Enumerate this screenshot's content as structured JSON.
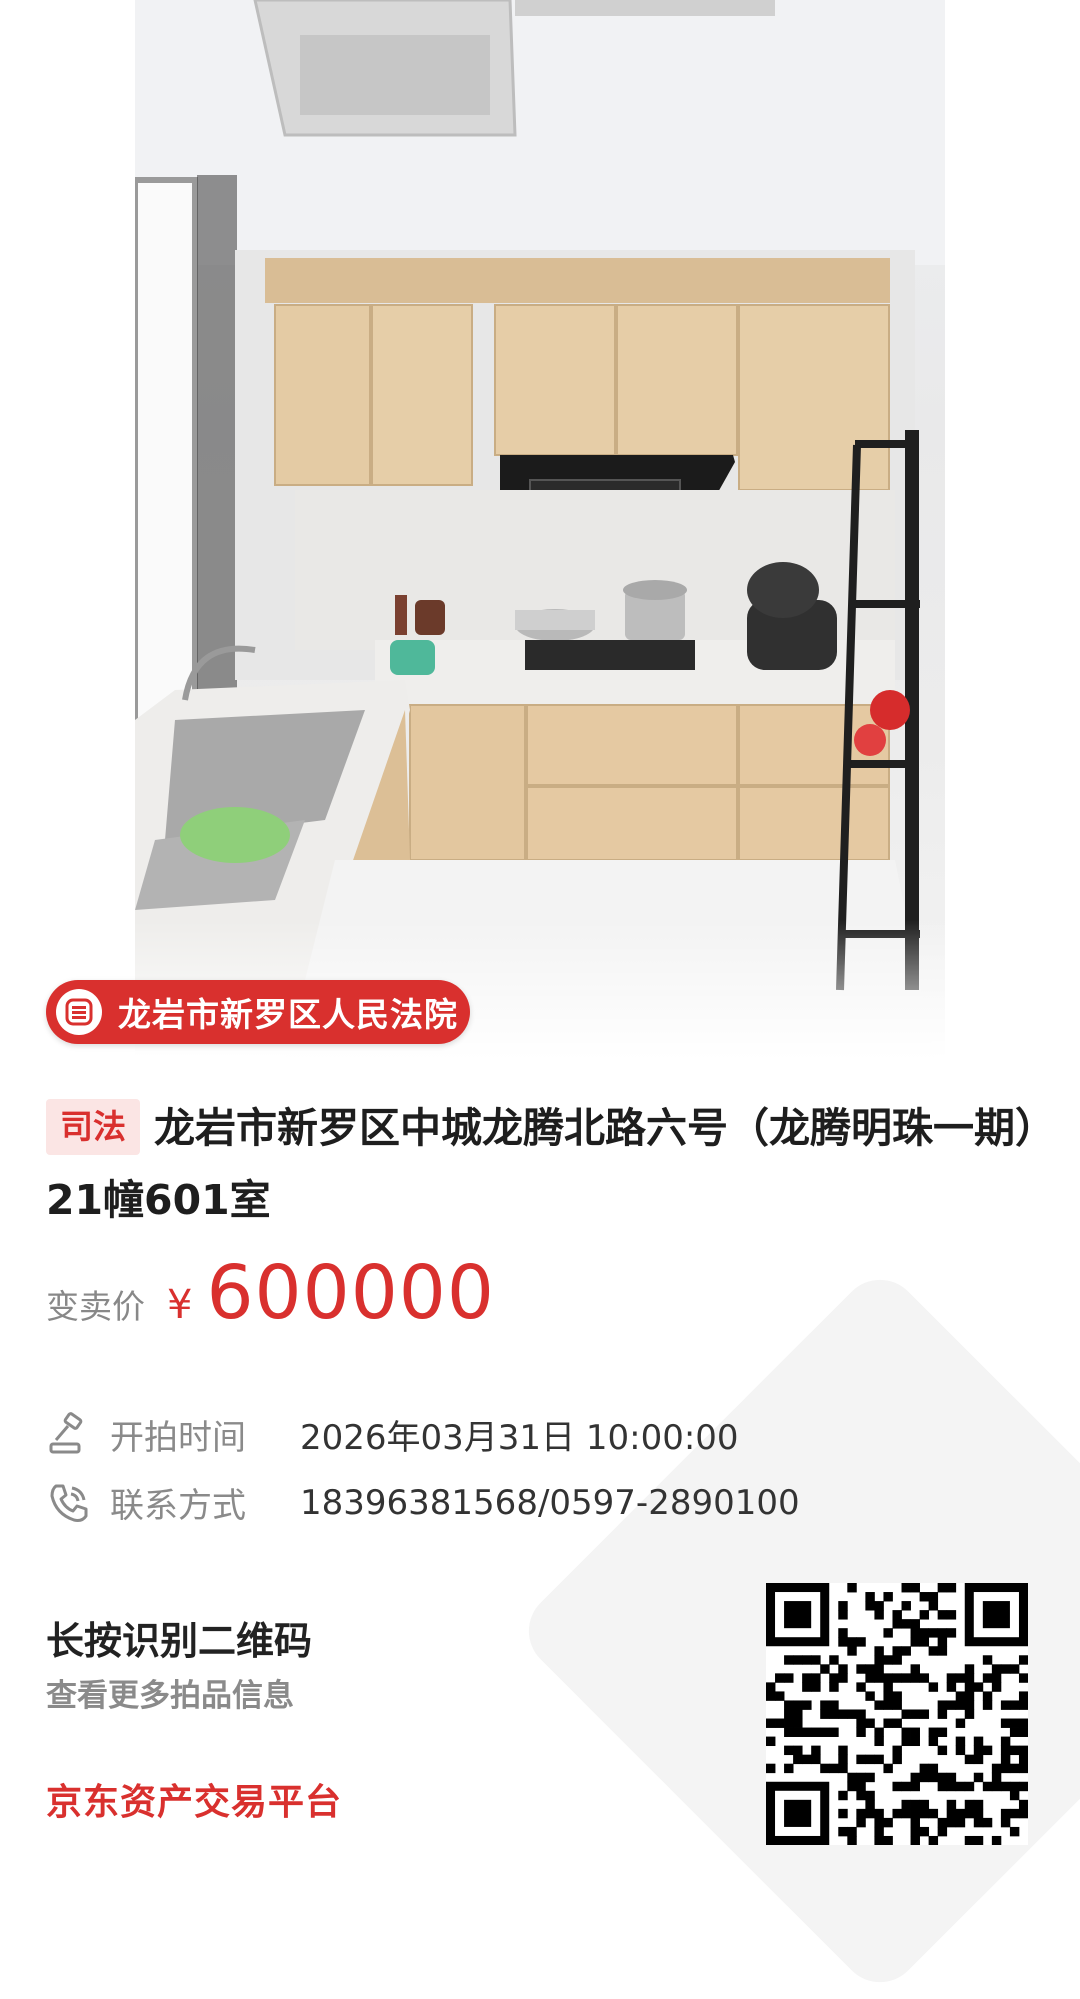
{
  "photo": {
    "alt_icon": "kitchen-photo"
  },
  "court": {
    "name": "龙岩市新罗区人民法院",
    "icon": "court-icon"
  },
  "listing": {
    "tag": "司法",
    "title": "龙岩市新罗区中城龙腾北路六号（龙腾明珠一期）21幢601室"
  },
  "price": {
    "label": "变卖价",
    "currency": "¥",
    "value": "600000"
  },
  "info": {
    "start_time": {
      "icon": "gavel-icon",
      "label": "开拍时间",
      "value": "2026年03月31日 10:00:00"
    },
    "contact": {
      "icon": "phone-icon",
      "label": "联系方式",
      "value": "18396381568/0597-2890100"
    }
  },
  "footer": {
    "qr_title": "长按识别二维码",
    "qr_subtitle": "查看更多拍品信息",
    "platform": "京东资产交易平台",
    "qr_icon": "qr-code"
  },
  "colors": {
    "accent_red": "#d9302e",
    "tag_bg": "#fbe5e4",
    "muted_text": "#8a8a8a"
  }
}
